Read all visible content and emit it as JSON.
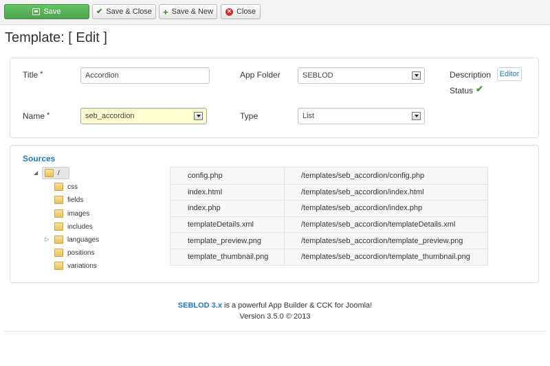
{
  "toolbar": {
    "save_label": "Save",
    "save_close_label": "Save & Close",
    "save_new_label": "Save & New",
    "close_label": "Close",
    "save_color": "#5bb75b"
  },
  "page_title": "Template: [ Edit ]",
  "form": {
    "title_label": "Title",
    "title_value": "Accordion",
    "name_label": "Name",
    "name_value": "seb_accordion",
    "app_folder_label": "App Folder",
    "app_folder_value": "SEBLOD",
    "type_label": "Type",
    "type_value": "List",
    "description_label": "Description",
    "editor_label": "Editor",
    "status_label": "Status",
    "required_mark": "*"
  },
  "sources": {
    "title": "Sources",
    "root": "/",
    "folders": [
      "css",
      "fields",
      "images",
      "includes",
      "languages",
      "positions",
      "variations"
    ],
    "files": [
      {
        "name": "config.php",
        "path": "/templates/seb_accordion/config.php"
      },
      {
        "name": "index.html",
        "path": "/templates/seb_accordion/index.html"
      },
      {
        "name": "index.php",
        "path": "/templates/seb_accordion/index.php"
      },
      {
        "name": "templateDetails.xml",
        "path": "/templates/seb_accordion/templateDetails.xml"
      },
      {
        "name": "template_preview.png",
        "path": "/templates/seb_accordion/template_preview.png"
      },
      {
        "name": "template_thumbnail.png",
        "path": "/templates/seb_accordion/template_thumbnail.png"
      }
    ]
  },
  "footer": {
    "brand": "SEBLOD 3.x",
    "tagline": " is a powerful App Builder & CCK for Joomla!",
    "version": "Version 3.5.0 © 2013",
    "brand_color": "#1e7ac0"
  }
}
